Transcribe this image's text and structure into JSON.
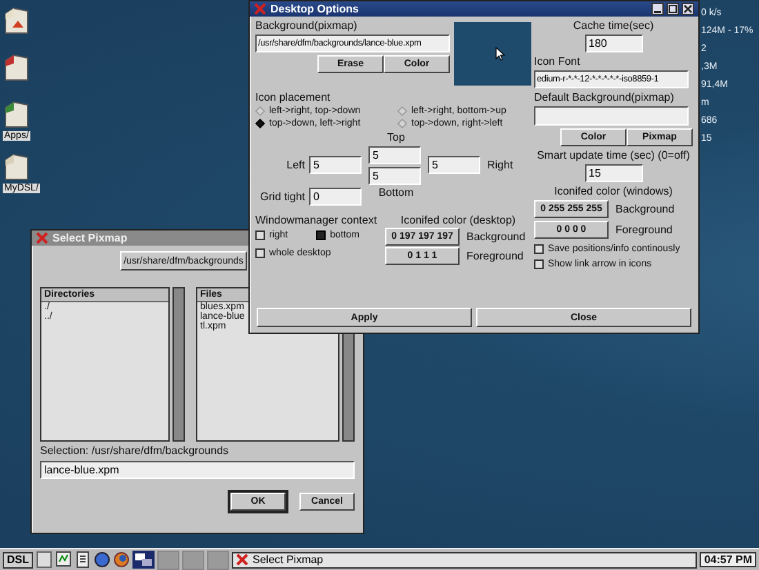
{
  "desktop_icons": [
    {
      "kind": "home"
    },
    {
      "kind": "red"
    },
    {
      "kind": "green",
      "label": "Apps/"
    },
    {
      "kind": "plain",
      "label": "MyDSL/"
    }
  ],
  "system_monitor": [
    "0 k/s",
    "124M - 17%",
    "2",
    ",3M",
    "91,4M",
    "m",
    "686",
    "15"
  ],
  "desktop_options": {
    "title": "Desktop Options",
    "background": {
      "label": "Background(pixmap)",
      "value": "/usr/share/dfm/backgrounds/lance-blue.xpm",
      "buttons": [
        "Erase",
        "Color"
      ]
    },
    "icon_placement": {
      "label": "Icon placement",
      "options": [
        {
          "label": "left->right, top->down",
          "selected": false
        },
        {
          "label": "left->right, bottom->up",
          "selected": false
        },
        {
          "label": "top->down, left->right",
          "selected": true
        },
        {
          "label": "top->down, right->left",
          "selected": false
        }
      ]
    },
    "margins": {
      "top": {
        "label": "Top",
        "value": "5"
      },
      "left": {
        "label": "Left",
        "value": "5"
      },
      "right": {
        "label": "Right",
        "value": "5"
      },
      "bottom": {
        "label": "Bottom",
        "value": "5"
      },
      "grid_tight": {
        "label": "Grid tight",
        "value": "0"
      }
    },
    "wm_context": {
      "label": "Windowmanager context",
      "options": [
        {
          "label": "right",
          "checked": false
        },
        {
          "label": "bottom",
          "checked": true
        },
        {
          "label": "whole desktop",
          "checked": false
        }
      ]
    },
    "iconified_desktop": {
      "label": "Iconifed color (desktop)",
      "rows": [
        {
          "value": "0 197 197 197",
          "label": "Background"
        },
        {
          "value": "0 1 1 1",
          "label": "Foreground"
        }
      ]
    },
    "cache_time": {
      "label": "Cache time(sec)",
      "value": "180"
    },
    "icon_font": {
      "label": "Icon Font",
      "value": "edium-r-*-*-12-*-*-*-*-*-iso8859-1"
    },
    "default_background": {
      "label": "Default Background(pixmap)",
      "buttons": [
        "Color",
        "Pixmap"
      ]
    },
    "smart_update": {
      "label": "Smart update time (sec) (0=off)",
      "value": "15"
    },
    "iconified_windows": {
      "label": "Iconifed color (windows)",
      "rows": [
        {
          "value": "0 255 255 255",
          "label": "Background"
        },
        {
          "value": "0 0 0 0",
          "label": "Foreground"
        }
      ]
    },
    "options": [
      {
        "label": "Save positions/info continously",
        "checked": false
      },
      {
        "label": "Show link arrow in icons",
        "checked": false
      }
    ],
    "buttons": [
      "Apply",
      "Close"
    ]
  },
  "select_pixmap": {
    "title": "Select Pixmap",
    "path": "/usr/share/dfm/backgrounds",
    "directories": {
      "heading": "Directories",
      "items": [
        "./",
        "../"
      ]
    },
    "files": {
      "heading": "Files",
      "items": [
        "blues.xpm",
        "lance-blue",
        "tl.xpm"
      ]
    },
    "selection_label": "Selection: /usr/share/dfm/backgrounds",
    "selection_value": "lance-blue.xpm",
    "buttons": [
      "OK",
      "Cancel"
    ]
  },
  "taskbar": {
    "start": "DSL",
    "task": "Select Pixmap",
    "clock": "04:57 PM"
  }
}
